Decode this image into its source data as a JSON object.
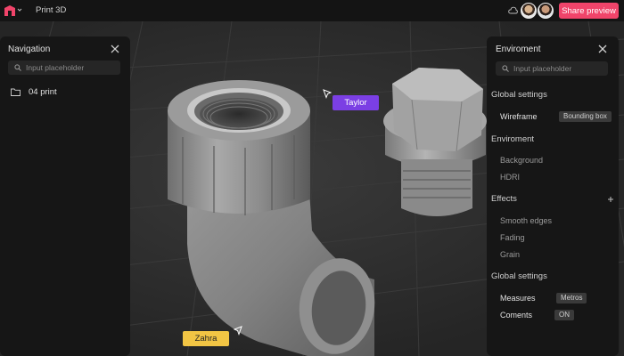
{
  "app": {
    "title": "Print 3D"
  },
  "header": {
    "share_label": "Share preview"
  },
  "icons": {
    "logo": "logo-icon",
    "chevron": "chevron-down-icon",
    "cloud": "cloud-icon",
    "close": "close-icon",
    "search": "search-icon",
    "folder": "folder-icon",
    "plus": "plus-icon",
    "cursor": "cursor-icon"
  },
  "colors": {
    "accent": "#f0446a",
    "taylor": "#7b3fe4",
    "zahra": "#f2c544"
  },
  "navigation": {
    "title": "Navigation",
    "search_placeholder": "Input placeholder",
    "items": [
      {
        "label": "04 print"
      }
    ]
  },
  "environment": {
    "title": "Enviroment",
    "search_placeholder": "Input placeholder",
    "global1": {
      "heading": "Global settings",
      "wireframe_label": "Wireframe",
      "wireframe_value": "Bounding box"
    },
    "env": {
      "heading": "Enviroment",
      "background_label": "Background",
      "hdri_label": "HDRI"
    },
    "effects": {
      "heading": "Effects",
      "smooth_label": "Smooth edges",
      "fading_label": "Fading",
      "grain_label": "Grain"
    },
    "global2": {
      "heading": "Global settings",
      "measures_label": "Measures",
      "measures_value": "Metros",
      "coments_label": "Coments",
      "coments_value": "ON"
    }
  },
  "collaborators": [
    {
      "name": "Taylor"
    },
    {
      "name": "Zahra"
    }
  ]
}
